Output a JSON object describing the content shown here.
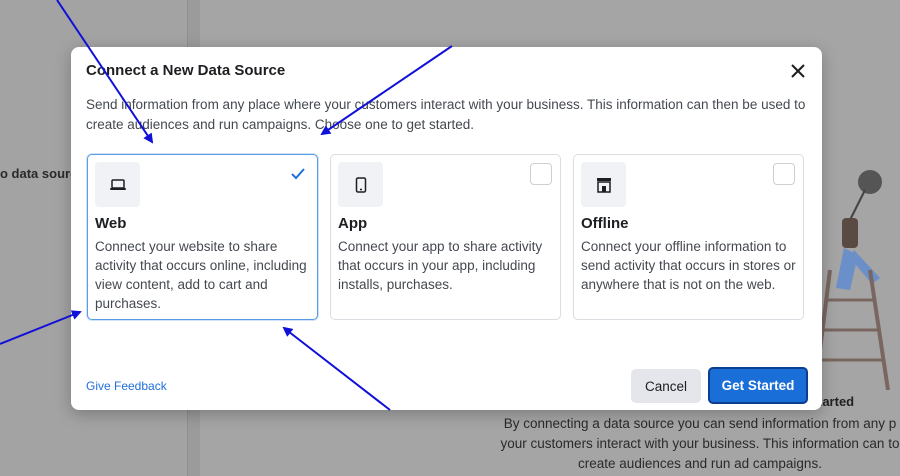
{
  "background": {
    "left_text": "o data source",
    "started_text": "tarted",
    "description": "By connecting a data source you can send information from any p your customers interact with your business. This information can to create audiences and run ad campaigns."
  },
  "modal": {
    "title": "Connect a New Data Source",
    "description": "Send information from any place where your customers interact with your business. This information can then be used to create audiences and run campaigns. Choose one to get started.",
    "cards": [
      {
        "title": "Web",
        "text": "Connect your website to share activity that occurs online, including view content, add to cart and purchases.",
        "icon": "laptop-icon",
        "selected": true
      },
      {
        "title": "App",
        "text": "Connect your app to share activity that occurs in your app, including installs, purchases.",
        "icon": "phone-icon",
        "selected": false
      },
      {
        "title": "Offline",
        "text": "Connect your offline information to send activity that occurs in stores or anywhere that is not on the web.",
        "icon": "storefront-icon",
        "selected": false
      }
    ],
    "feedback_label": "Give Feedback",
    "cancel_label": "Cancel",
    "start_label": "Get Started"
  },
  "colors": {
    "primary": "#1a6ed8",
    "link": "#216fdb",
    "selected_border": "#5a9be6",
    "arrow": "#1010d8"
  }
}
